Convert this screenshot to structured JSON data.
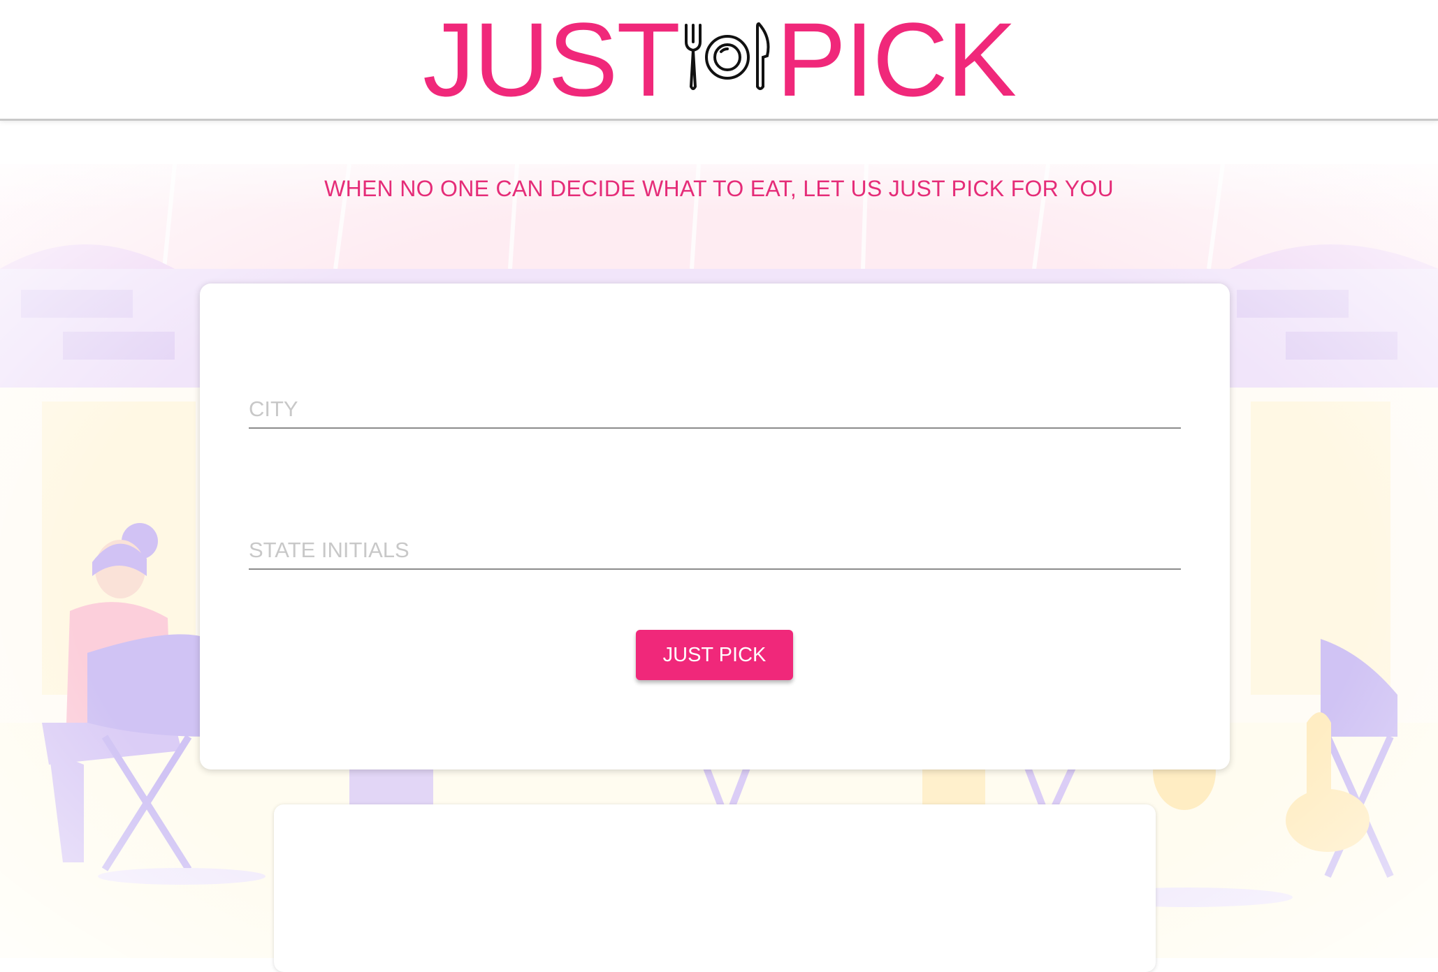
{
  "logo": {
    "left_text": "JUST",
    "right_text": "PICK",
    "icon": "plate-fork-knife-icon",
    "color": "#f0287a"
  },
  "tagline": "WHEN NO ONE CAN DECIDE WHAT TO EAT, LET US JUST PICK FOR YOU",
  "form": {
    "city_placeholder": "CITY",
    "state_placeholder": "STATE INITIALS",
    "submit_label": "JUST PICK"
  },
  "colors": {
    "accent": "#f0287a",
    "illustration_pink": "#f8c6dd",
    "illustration_purple": "#c7b3f0",
    "illustration_yellow": "#fff1b8"
  }
}
